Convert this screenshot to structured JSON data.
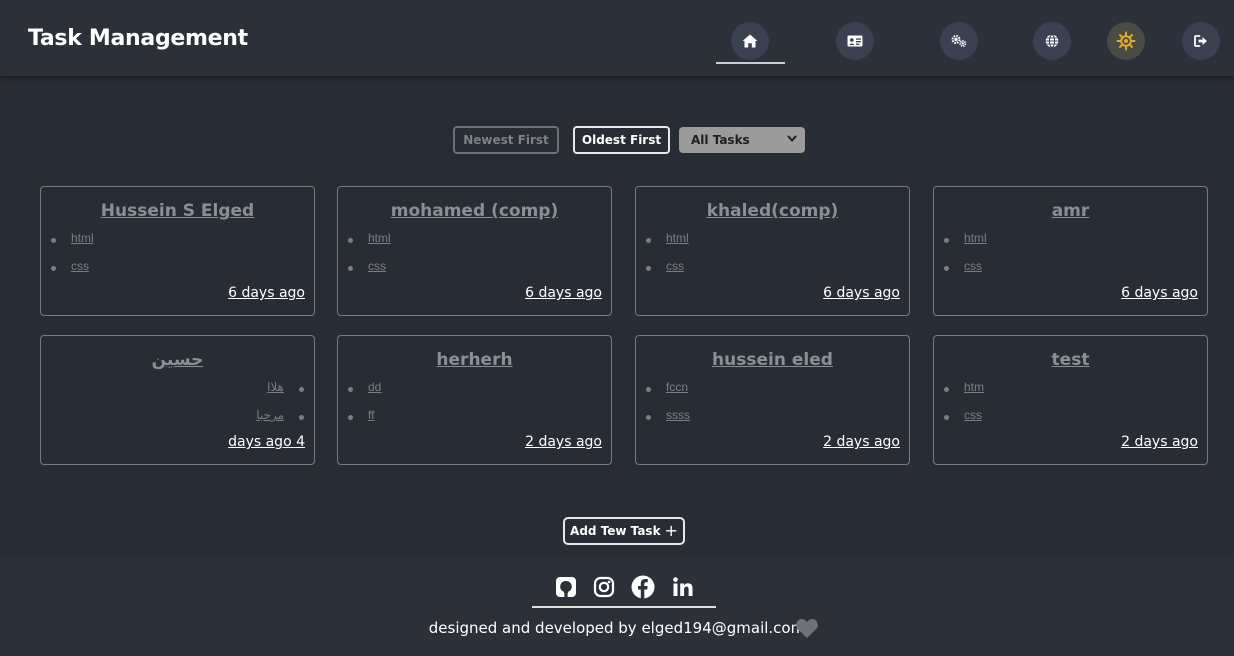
{
  "header": {
    "brand": "Task Management",
    "nav": [
      {
        "name": "home-icon"
      },
      {
        "name": "id-card-icon"
      },
      {
        "name": "gears-icon"
      },
      {
        "name": "globe-icon"
      },
      {
        "name": "sun-icon"
      },
      {
        "name": "logout-icon"
      }
    ]
  },
  "controls": {
    "newest_label": "Newest First",
    "oldest_label": "Oldest First",
    "filter_selected": "All Tasks"
  },
  "cards": [
    {
      "title": "Hussein S Elged",
      "items": [
        "html",
        "css"
      ],
      "date": "6 days ago"
    },
    {
      "title": "mohamed (comp)",
      "items": [
        "html",
        "css"
      ],
      "date": "6 days ago"
    },
    {
      "title": "khaled(comp)",
      "items": [
        "html",
        "css"
      ],
      "date": "6 days ago"
    },
    {
      "title": "amr",
      "items": [
        "html",
        "css"
      ],
      "date": "6 days ago"
    },
    {
      "title": "حسين",
      "items": [
        "هلاا",
        "مرحبا"
      ],
      "date": "days ago 4"
    },
    {
      "title": "herherh",
      "items": [
        "dd",
        "ff"
      ],
      "date": "2 days ago"
    },
    {
      "title": "hussein eled",
      "items": [
        "fccn",
        "ssss"
      ],
      "date": "2 days ago"
    },
    {
      "title": "test",
      "items": [
        "htm",
        "css"
      ],
      "date": "2 days ago"
    }
  ],
  "add_button": {
    "label": "Add Tew Task",
    "plus": "+"
  },
  "footer": {
    "social": [
      "github-icon",
      "instagram-icon",
      "facebook-icon",
      "linkedin-icon"
    ],
    "credits": "designed and developed by elged194@gmail.com"
  },
  "colors": {
    "background": "#282c34",
    "header_bg": "#2c3038",
    "nav_circle": "#3a4150",
    "accent_sun": "#e0a92a",
    "muted_text": "#8a8f97"
  }
}
